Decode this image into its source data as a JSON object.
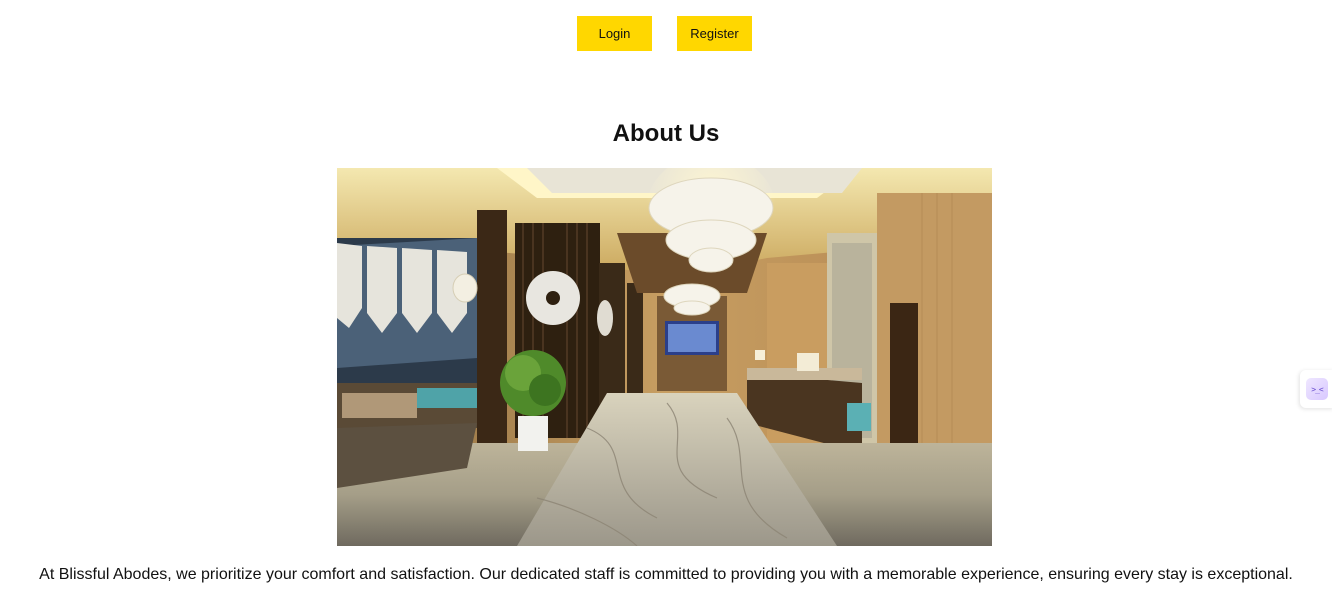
{
  "nav": {
    "login_label": "Login",
    "register_label": "Register",
    "button_color": "#ffd700"
  },
  "about": {
    "title": "About Us",
    "image_alt": "Hotel lobby with chandeliers and marble floor",
    "text": "At Blissful Abodes, we prioritize your comfort and satisfaction. Our dedicated staff is committed to providing you with a memorable experience, ensuring every stay is exceptional."
  },
  "side_widget": {
    "icon": "assistant-icon",
    "glyph": ">_<"
  }
}
